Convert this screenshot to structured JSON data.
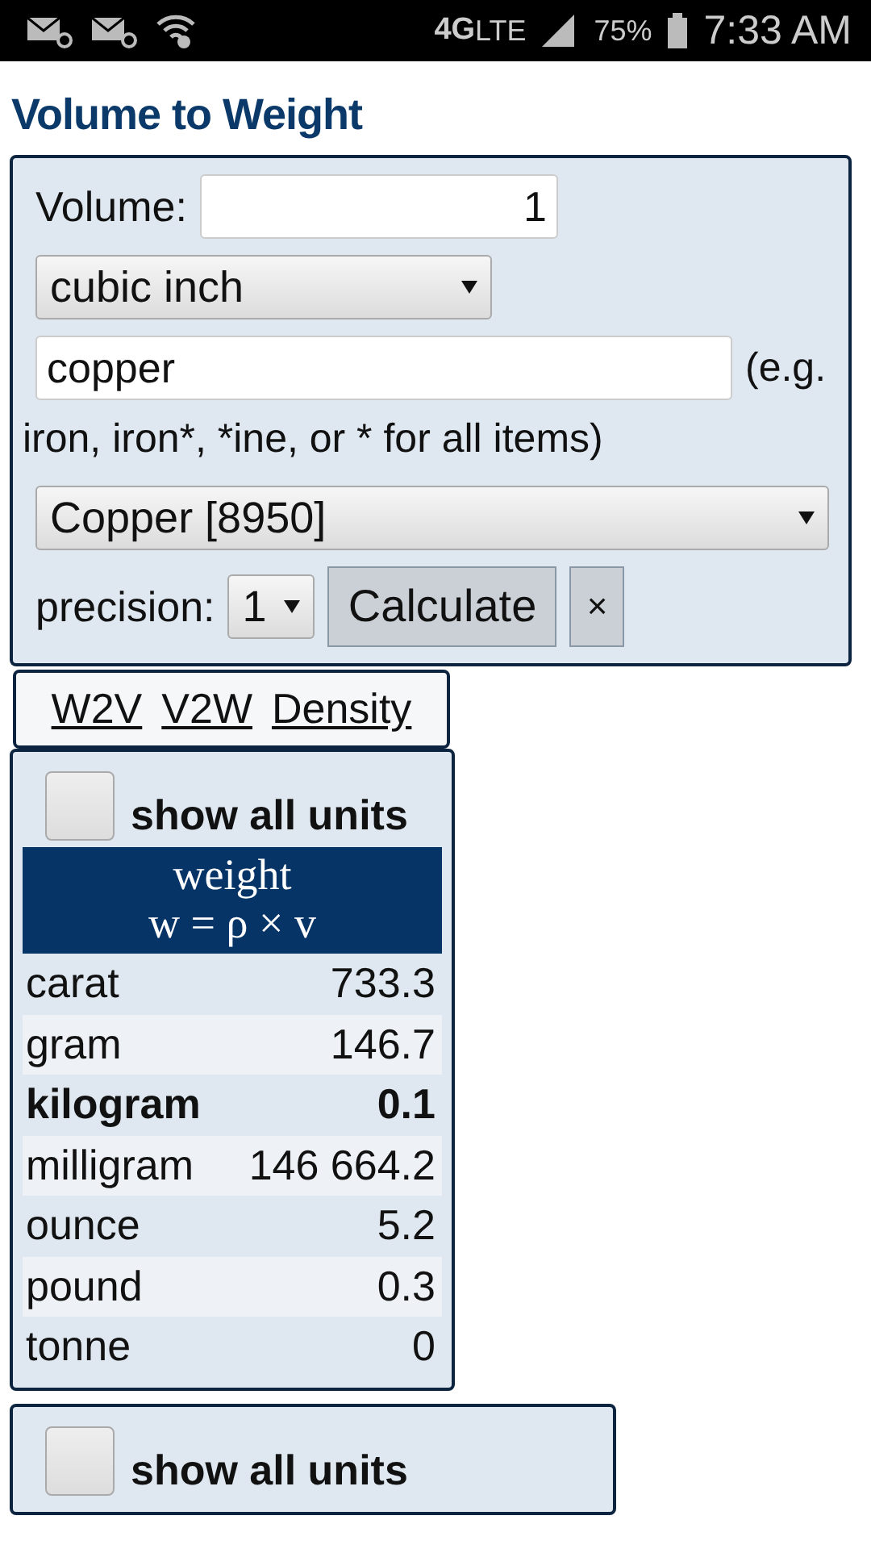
{
  "status_bar": {
    "network": "4G",
    "network_sub": "LTE",
    "battery": "75%",
    "time": "7:33 AM"
  },
  "title": "Volume to Weight",
  "form": {
    "volume_label": "Volume:",
    "volume_value": "1",
    "unit": "cubic inch",
    "search_value": "copper",
    "hint": "(e.g.",
    "hint_continued": "iron, iron*, *ine, or * for all items)",
    "material": "Copper [8950]",
    "precision_label": "precision:",
    "precision": "1",
    "calculate": "Calculate",
    "clear": "×"
  },
  "links": [
    "W2V",
    "V2W",
    "Density"
  ],
  "result_panels": [
    {
      "checkbox_label": "show all units",
      "checked": false,
      "header": "weight",
      "formula": "w = ρ × v",
      "rows": [
        {
          "unit": "carat",
          "value": "733.3",
          "bold": false
        },
        {
          "unit": "gram",
          "value": "146.7",
          "bold": false
        },
        {
          "unit": "kilogram",
          "value": "0.1",
          "bold": true
        },
        {
          "unit": "milligram",
          "value": "146 664.2",
          "bold": false
        },
        {
          "unit": "ounce",
          "value": "5.2",
          "bold": false
        },
        {
          "unit": "pound",
          "value": "0.3",
          "bold": false
        },
        {
          "unit": "tonne",
          "value": "0",
          "bold": false
        }
      ]
    },
    {
      "checkbox_label": "show all units",
      "checked": false
    }
  ]
}
